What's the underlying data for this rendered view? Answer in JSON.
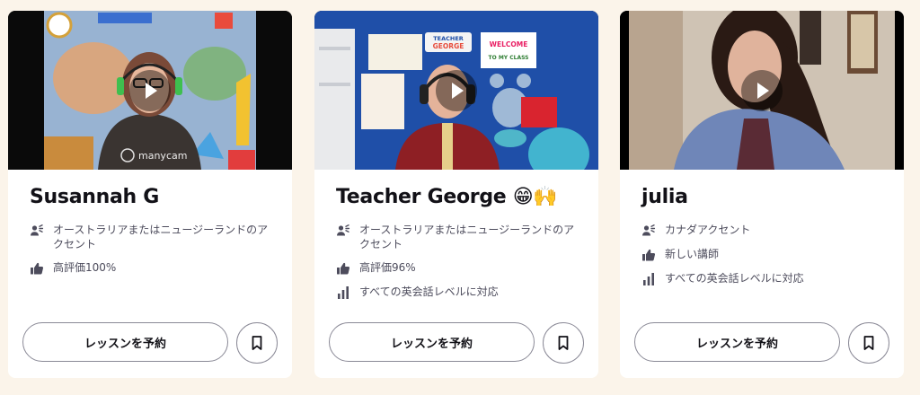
{
  "tutors": [
    {
      "name": "Susannah G",
      "features": [
        {
          "icon": "accent-speaker-icon",
          "text": "オーストラリアまたはニュージーランドのアクセント"
        },
        {
          "icon": "thumbs-up-icon",
          "text": "高評価100%"
        }
      ],
      "book_label": "レッスンを予約",
      "watermark": "manycam"
    },
    {
      "name": "Teacher George 😁🙌",
      "features": [
        {
          "icon": "accent-speaker-icon",
          "text": "オーストラリアまたはニュージーランドのアクセント"
        },
        {
          "icon": "thumbs-up-icon",
          "text": "高評価96%"
        },
        {
          "icon": "level-bars-icon",
          "text": "すべての英会話レベルに対応"
        }
      ],
      "book_label": "レッスンを予約",
      "signs": {
        "title_top": "TEACHER",
        "title_bottom": "GEORGE",
        "welcome": "WELCOME",
        "class": "TO MY CLASS"
      }
    },
    {
      "name": "julia",
      "features": [
        {
          "icon": "accent-speaker-icon",
          "text": "カナダアクセント"
        },
        {
          "icon": "thumbs-up-icon",
          "text": "新しい講師"
        },
        {
          "icon": "level-bars-icon",
          "text": "すべての英会話レベルに対応"
        }
      ],
      "book_label": "レッスンを予約"
    }
  ],
  "colors": {
    "background": "#fbf4ea",
    "card": "#ffffff",
    "text": "#121117",
    "muted": "#4d4c5c",
    "border": "#8a8996"
  }
}
